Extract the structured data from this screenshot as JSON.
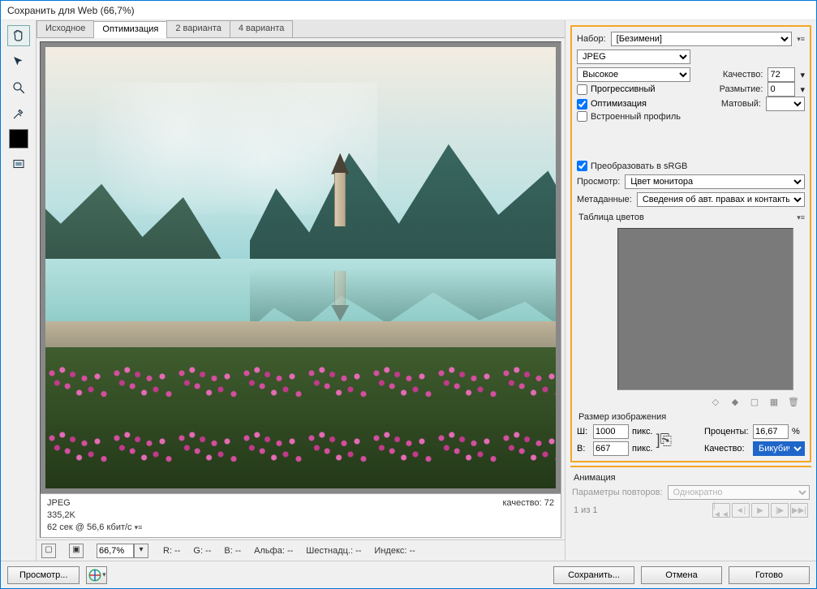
{
  "title": "Сохранить для Web (66,7%)",
  "tabs": [
    "Исходное",
    "Оптимизация",
    "2 варианта",
    "4 варианта"
  ],
  "active_tab_index": 1,
  "image_info": {
    "format": "JPEG",
    "size": "335,2K",
    "time": "62 сек @ 56,6 кбит/с",
    "quality_label": "качество: 72"
  },
  "status": {
    "zoom": "66,7%",
    "R": "R: --",
    "G": "G: --",
    "B": "B: --",
    "alpha": "Альфа: --",
    "hex": "Шестнадц.: --",
    "index": "Индекс: --"
  },
  "preset": {
    "label": "Набор:",
    "value": "[Безимени]",
    "format": "JPEG",
    "quality_preset": "Высокое",
    "quality_label": "Качество:",
    "quality_value": "72",
    "progressive": "Прогрессивный",
    "blur_label": "Размытие:",
    "blur_value": "0",
    "optimize": "Оптимизация",
    "matte_label": "Матовый:",
    "embedded": "Встроенный профиль",
    "convert_srgb": "Преобразовать в sRGB",
    "preview_label": "Просмотр:",
    "preview_value": "Цвет монитора",
    "metadata_label": "Метаданные:",
    "metadata_value": "Сведения об авт. правах и контакты"
  },
  "color_table": {
    "label": "Таблица цветов"
  },
  "image_size": {
    "label": "Размер изображения",
    "w_label": "Ш:",
    "w": "1000",
    "w_unit": "пикс.",
    "h_label": "В:",
    "h": "667",
    "h_unit": "пикс.",
    "percent_label": "Проценты:",
    "percent": "16,67",
    "percent_unit": "%",
    "quality_label": "Качество:",
    "quality_value": "Бикубическая"
  },
  "animation": {
    "label": "Анимация",
    "loop_label": "Параметры повторов:",
    "loop_value": "Однократно",
    "frame": "1 из 1"
  },
  "footer": {
    "preview": "Просмотр...",
    "save": "Сохранить...",
    "cancel": "Отмена",
    "done": "Готово"
  }
}
